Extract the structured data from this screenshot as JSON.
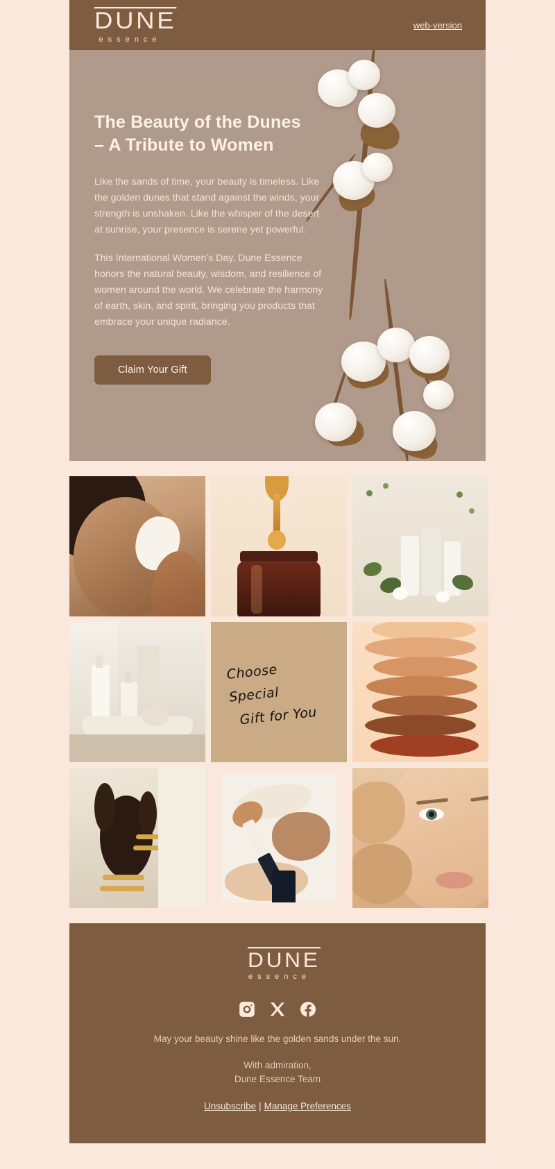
{
  "brand": {
    "name": "DUNE",
    "tagline": "essence",
    "colors": {
      "page_bg": "#fbe8dc",
      "brand_brown": "#7d5c3f",
      "hero_bg": "#b09a8b",
      "cream": "#fbeadd"
    }
  },
  "header": {
    "web_version_label": "web-version"
  },
  "hero": {
    "title_line1": "The Beauty of the Dunes",
    "title_line2": "– A Tribute to Women",
    "paragraph1": "Like the sands of time, your beauty is timeless. Like the golden dunes that stand against the winds, your strength is unshaken. Like the whisper of the desert at sunrise, your presence is serene yet powerful.",
    "paragraph2": "This International Women's Day, Dune Essence honors the natural beauty, wisdom, and resilience of women around the world. We celebrate the harmony of earth, skin, and spirit, bringing you products that embrace your unique radiance.",
    "cta_label": "Claim Your Gift"
  },
  "gallery": {
    "tiles": [
      {
        "name": "woman-applying-cream",
        "alt": "Woman applying face cream"
      },
      {
        "name": "serum-dropper-bottle",
        "alt": "Serum dropper over amber bottle"
      },
      {
        "name": "skincare-bottles-with-blossoms",
        "alt": "Skincare bottles with white blossoms"
      },
      {
        "name": "bottles-on-stone-pedestal",
        "alt": "Cosmetic bottles on stone pedestal"
      },
      {
        "name": "handwritten-gift-note",
        "alt": "Handwritten note card"
      },
      {
        "name": "foundation-shade-swatches",
        "alt": "Foundation shade swatches"
      },
      {
        "name": "hand-with-gold-jewelry",
        "alt": "Hand with gold rings and bangles"
      },
      {
        "name": "makeup-brush-and-foundation",
        "alt": "Makeup brush with foundation smear"
      },
      {
        "name": "model-face-closeup",
        "alt": "Close-up of model face with foundation"
      }
    ],
    "note_line1": "Choose Special",
    "note_line2": "Gift for You"
  },
  "footer": {
    "socials": [
      {
        "name": "instagram-icon",
        "label": "Instagram"
      },
      {
        "name": "x-icon",
        "label": "X"
      },
      {
        "name": "facebook-icon",
        "label": "Facebook"
      }
    ],
    "message": "May your beauty shine like the golden sands under the sun.",
    "sign_off_line1": "With admiration,",
    "sign_off_line2": "Dune Essence Team",
    "unsubscribe_label": "Unsubscribe",
    "links_separator": "|",
    "preferences_label": "Manage Preferences"
  }
}
